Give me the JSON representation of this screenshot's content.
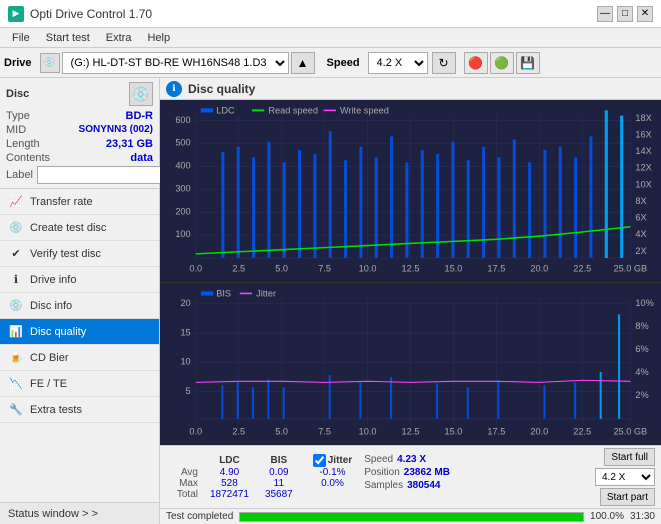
{
  "app": {
    "title": "Opti Drive Control 1.70",
    "title_icon": "CD"
  },
  "title_controls": {
    "minimize": "—",
    "maximize": "□",
    "close": "✕"
  },
  "menu": {
    "items": [
      "File",
      "Start test",
      "Extra",
      "Help"
    ]
  },
  "drive_toolbar": {
    "drive_label": "Drive",
    "drive_value": "(G:)  HL-DT-ST BD-RE  WH16NS48 1.D3",
    "eject_icon": "▲",
    "speed_label": "Speed",
    "speed_value": "4.2 X"
  },
  "disc": {
    "title": "Disc",
    "type_label": "Type",
    "type_value": "BD-R",
    "mid_label": "MID",
    "mid_value": "SONYNN3 (002)",
    "length_label": "Length",
    "length_value": "23,31 GB",
    "contents_label": "Contents",
    "contents_value": "data",
    "label_label": "Label",
    "label_value": ""
  },
  "nav": {
    "items": [
      {
        "id": "transfer-rate",
        "label": "Transfer rate",
        "icon": "📈"
      },
      {
        "id": "create-test-disc",
        "label": "Create test disc",
        "icon": "💿"
      },
      {
        "id": "verify-test-disc",
        "label": "Verify test disc",
        "icon": "✔"
      },
      {
        "id": "drive-info",
        "label": "Drive info",
        "icon": "ℹ"
      },
      {
        "id": "disc-info",
        "label": "Disc info",
        "icon": "💿"
      },
      {
        "id": "disc-quality",
        "label": "Disc quality",
        "icon": "📊",
        "active": true
      },
      {
        "id": "cd-bier",
        "label": "CD Bier",
        "icon": "🍺"
      },
      {
        "id": "fe-te",
        "label": "FE / TE",
        "icon": "📉"
      },
      {
        "id": "extra-tests",
        "label": "Extra tests",
        "icon": "🔧"
      }
    ]
  },
  "status_window": {
    "label": "Status window > >"
  },
  "disc_quality": {
    "title": "Disc quality"
  },
  "legend_top": {
    "ldc_label": "LDC",
    "read_label": "Read speed",
    "write_label": "Write speed"
  },
  "legend_bottom": {
    "bis_label": "BIS",
    "jitter_label": "Jitter"
  },
  "chart_top": {
    "y_axis": [
      "600",
      "500",
      "400",
      "300",
      "200",
      "100"
    ],
    "y_axis_right": [
      "18X",
      "16X",
      "14X",
      "12X",
      "10X",
      "8X",
      "6X",
      "4X",
      "2X"
    ],
    "x_axis": [
      "0.0",
      "2.5",
      "5.0",
      "7.5",
      "10.0",
      "12.5",
      "15.0",
      "17.5",
      "20.0",
      "22.5",
      "25.0 GB"
    ]
  },
  "chart_bottom": {
    "y_axis": [
      "20",
      "15",
      "10",
      "5"
    ],
    "y_axis_right": [
      "10%",
      "8%",
      "6%",
      "4%",
      "2%"
    ],
    "x_axis": [
      "0.0",
      "2.5",
      "5.0",
      "7.5",
      "10.0",
      "12.5",
      "15.0",
      "17.5",
      "20.0",
      "22.5",
      "25.0 GB"
    ]
  },
  "stats": {
    "ldc_header": "LDC",
    "bis_header": "BIS",
    "jitter_header": "Jitter",
    "avg_label": "Avg",
    "max_label": "Max",
    "total_label": "Total",
    "ldc_avg": "4.90",
    "ldc_max": "528",
    "ldc_total": "1872471",
    "bis_avg": "0.09",
    "bis_max": "11",
    "bis_total": "35687",
    "jitter_avg": "-0.1%",
    "jitter_max": "0.0%",
    "speed_label": "Speed",
    "speed_value": "4.23 X",
    "position_label": "Position",
    "position_value": "23862 MB",
    "samples_label": "Samples",
    "samples_value": "380544",
    "speed_select": "4.2 X"
  },
  "buttons": {
    "start_full": "Start full",
    "start_part": "Start part"
  },
  "progress": {
    "percent": "100.0%",
    "bar_width": "100",
    "time": "31:30"
  },
  "status": {
    "text": "Test completed"
  },
  "jitter_check": "Jitter"
}
